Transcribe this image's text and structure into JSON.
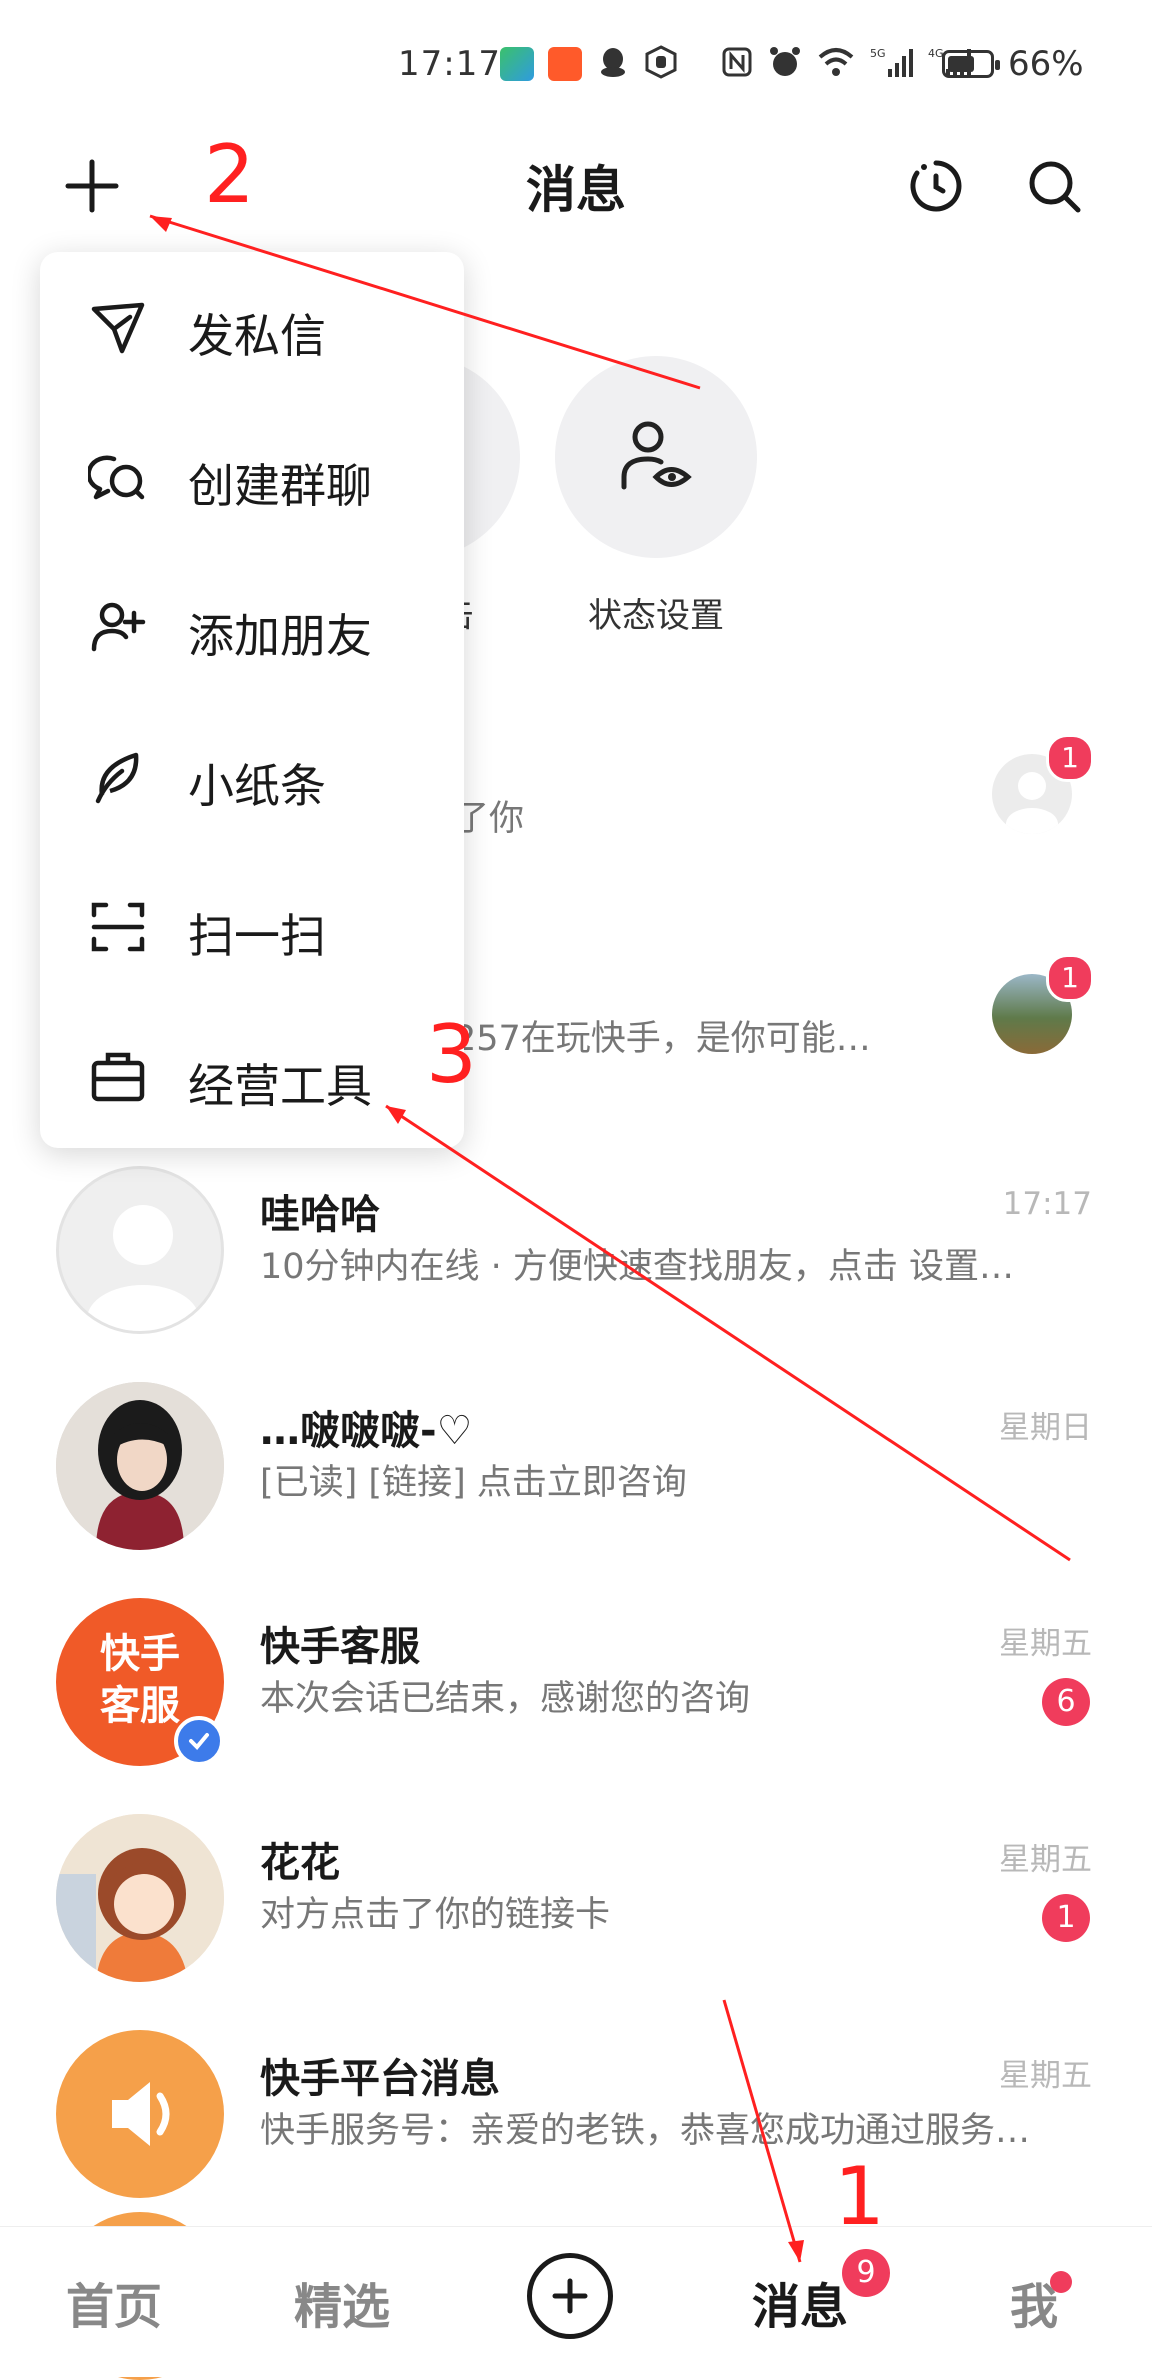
{
  "status_bar": {
    "time": "17:17",
    "battery": "66%",
    "battery_level": 0.66,
    "icons": [
      "app-icon-1",
      "app-icon-2",
      "qq-icon",
      "hand-icon",
      "nfc-icon",
      "alarm-icon",
      "wifi-icon",
      "signal-5g-icon",
      "signal-4g-icon"
    ]
  },
  "header": {
    "title": "消息",
    "left_button": "plus-icon",
    "right_buttons": [
      "refresh-icon",
      "search-icon"
    ]
  },
  "status_row": {
    "setting_label": "状态设置",
    "hidden_label_fragment": "缶"
  },
  "menu": {
    "items": [
      {
        "label": "发私信",
        "icon": "send-icon"
      },
      {
        "label": "创建群聊",
        "icon": "group-chat-icon"
      },
      {
        "label": "添加朋友",
        "icon": "add-friend-icon"
      },
      {
        "label": "小纸条",
        "icon": "feather-icon"
      },
      {
        "label": "扫一扫",
        "icon": "scan-icon"
      },
      {
        "label": "经营工具",
        "icon": "briefcase-icon"
      }
    ]
  },
  "partial_rows": [
    {
      "msg_fragment": "了你",
      "badge": "1"
    },
    {
      "msg_fragment": "257在玩快手，是你可能…",
      "badge": "1"
    }
  ],
  "conversations": [
    {
      "name": "哇哈哈",
      "message": "10分钟内在线 · 方便快速查找朋友，点击 设置…",
      "time": "17:17",
      "badge": ""
    },
    {
      "name": "…啵啵啵-♡",
      "message": "[已读] [链接] 点击立即咨询",
      "time": "星期日",
      "badge": ""
    },
    {
      "name": "快手客服",
      "message": "本次会话已结束，感谢您的咨询",
      "time": "星期五",
      "badge": "6",
      "avatar_text": "快手\n客服"
    },
    {
      "name": "花花",
      "message": "对方点击了你的链接卡",
      "time": "星期五",
      "badge": "1"
    },
    {
      "name": "快手平台消息",
      "message": "快手服务号：亲爱的老铁，恭喜您成功通过服务…",
      "time": "星期五",
      "badge": ""
    }
  ],
  "bottom_nav": {
    "tabs": [
      "首页",
      "精选",
      "消息",
      "我"
    ],
    "active": "消息",
    "message_badge": "9"
  },
  "annotations": [
    "1",
    "2",
    "3"
  ],
  "colors": {
    "badge": "#f03c5c",
    "kuaishou_orange": "#f05a28",
    "annotation_red": "#ff2020",
    "speaker_orange": "#f5a04a"
  }
}
